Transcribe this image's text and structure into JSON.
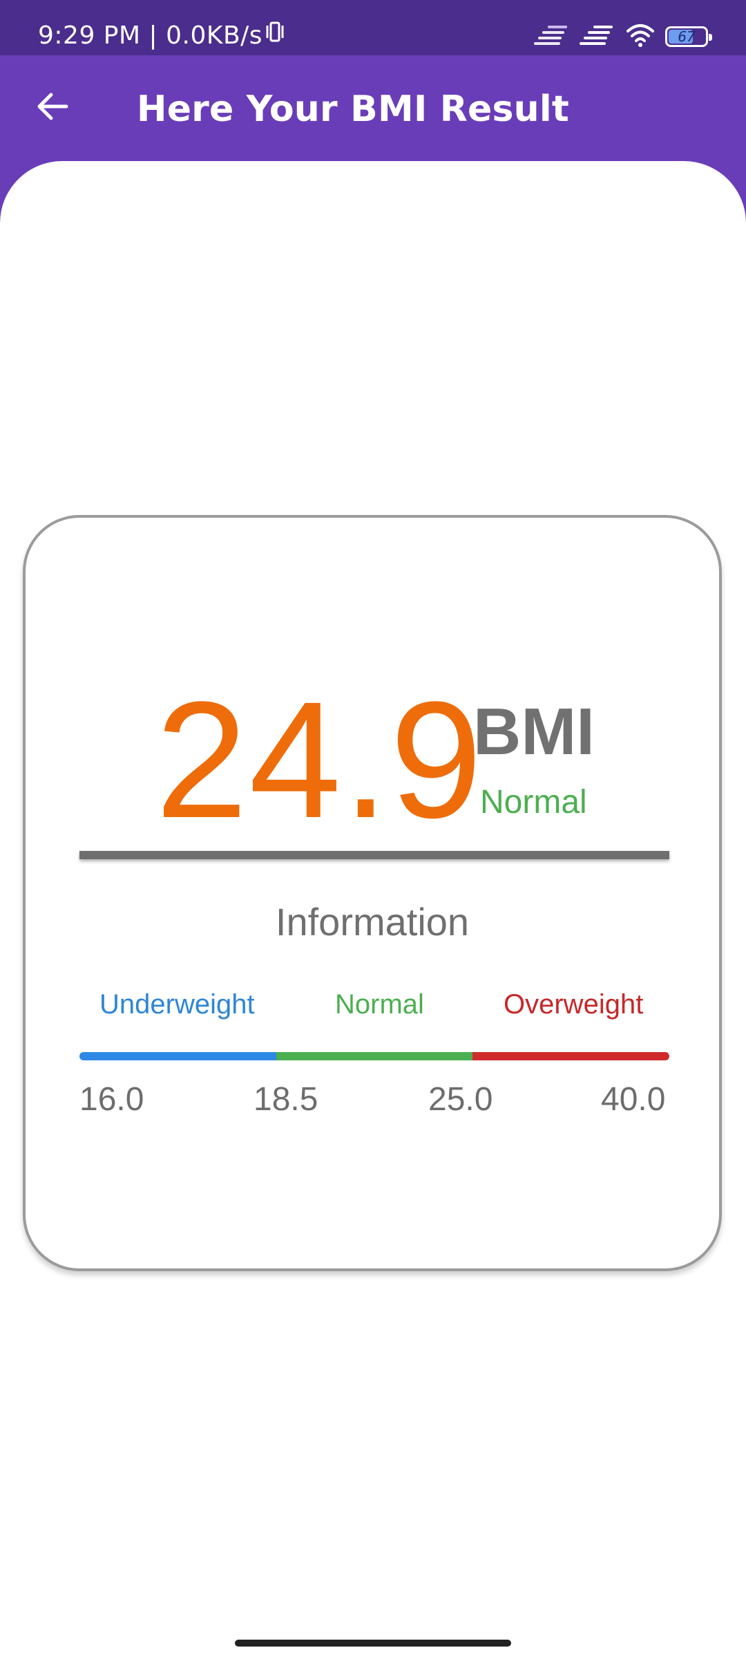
{
  "status_bar": {
    "time": "9:29 PM",
    "separator": "|",
    "net_speed": "0.0KB/s",
    "battery_level": "67",
    "battery_fraction": 0.67,
    "icons": [
      "vibrate-icon",
      "signal-icon",
      "signal-icon",
      "wifi-icon",
      "battery-icon"
    ]
  },
  "app_bar": {
    "title": "Here Your BMI Result",
    "back_icon": "back-arrow-icon",
    "color": "#6a3db8"
  },
  "result": {
    "value": "24.9",
    "unit": "BMI",
    "category": "Normal",
    "value_color": "#ee6c0a",
    "category_color": "#4caf50"
  },
  "information": {
    "heading": "Information",
    "ranges": [
      {
        "label": "Underweight",
        "color": "#2f86d6"
      },
      {
        "label": "Normal",
        "color": "#4caf50"
      },
      {
        "label": "Overweight",
        "color": "#c62828"
      }
    ],
    "ticks": [
      "16.0",
      "18.5",
      "25.0",
      "40.0"
    ]
  }
}
